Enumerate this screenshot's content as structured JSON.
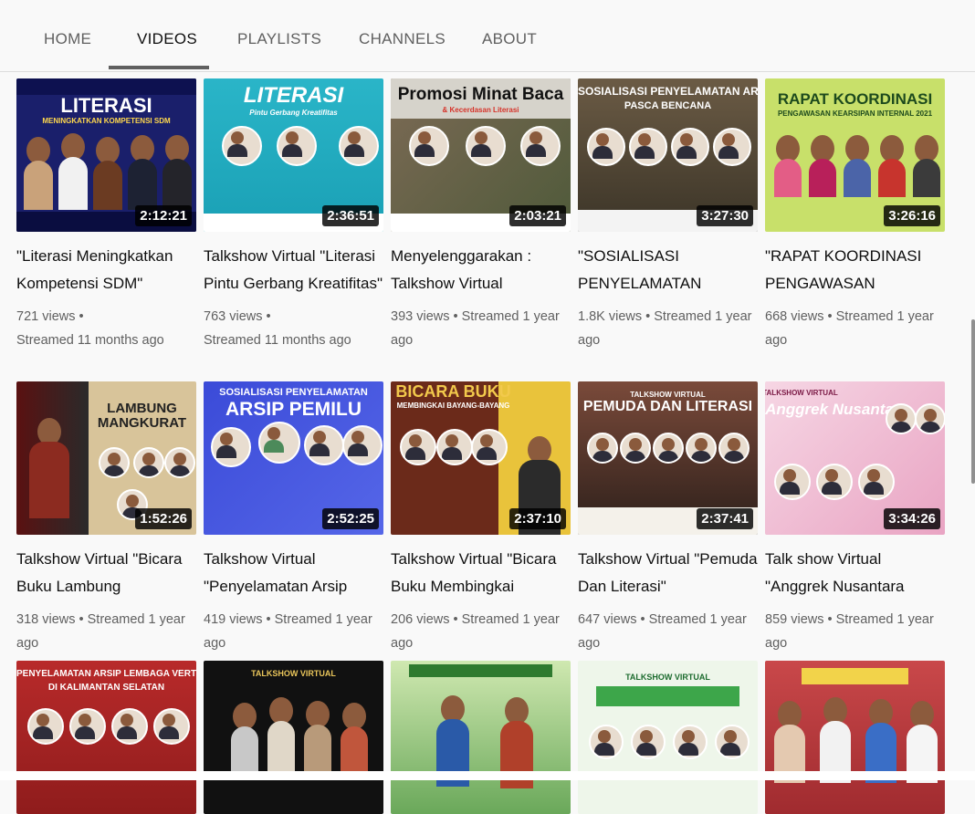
{
  "tabs": [
    {
      "label": "HOME"
    },
    {
      "label": "VIDEOS"
    },
    {
      "label": "PLAYLISTS"
    },
    {
      "label": "CHANNELS"
    },
    {
      "label": "ABOUT"
    }
  ],
  "active_tab": "VIDEOS",
  "videos": [
    {
      "title": "\"Literasi Meningkatkan Kompetensi SDM\"",
      "views": "721 views",
      "date": "Streamed 11 months ago",
      "duration": "2:12:21",
      "thumb_title": "LITERASI",
      "thumb_sub": "MENINGKATKAN KOMPETENSI SDM"
    },
    {
      "title": "Talkshow Virtual \"Literasi Pintu Gerbang Kreatifitas\"",
      "views": "763 views",
      "date": "Streamed 11 months ago",
      "duration": "2:36:51",
      "thumb_title": "LITERASI",
      "thumb_sub": "Pintu Gerbang Kreatifitas"
    },
    {
      "title": "Menyelenggarakan : Talkshow Virtual \"Promosi...",
      "views": "393 views",
      "date": "Streamed 1 year ago",
      "duration": "2:03:21",
      "thumb_title": "Promosi Minat Baca",
      "thumb_sub": "& Kecerdasan Literasi"
    },
    {
      "title": "\"SOSIALISASI PENYELAMATAN ARSIP...",
      "views": "1.8K views",
      "date": "Streamed 1 year ago",
      "duration": "3:27:30",
      "thumb_title": "SOSIALISASI PENYELAMATAN ARSIP",
      "thumb_sub": "PASCA BENCANA"
    },
    {
      "title": "\"RAPAT KOORDINASI PENGAWASAN KEARSIPAN...",
      "views": "668 views",
      "date": "Streamed 1 year ago",
      "duration": "3:26:16",
      "thumb_title": "RAPAT KOORDINASI",
      "thumb_sub": "PENGAWASAN KEARSIPAN INTERNAL 2021"
    },
    {
      "title": "Talkshow Virtual \"Bicara Buku Lambung Mangkurat\"",
      "views": "318 views",
      "date": "Streamed 1 year ago",
      "duration": "1:52:26",
      "thumb_title": "LAMBUNG MANGKURAT",
      "thumb_sub": ""
    },
    {
      "title": "Talkshow Virtual \"Penyelamatan Arsip Pemilu\"",
      "views": "419 views",
      "date": "Streamed 1 year ago",
      "duration": "2:52:25",
      "thumb_title": "ARSIP PEMILU",
      "thumb_sub": "SOSIALISASI PENYELAMATAN"
    },
    {
      "title": "Talkshow Virtual \"Bicara Buku Membingkai Bayang-...",
      "views": "206 views",
      "date": "Streamed 1 year ago",
      "duration": "2:37:10",
      "thumb_title": "BICARA BUKU",
      "thumb_sub": "MEMBINGKAI BAYANG-BAYANG"
    },
    {
      "title": "Talkshow Virtual \"Pemuda Dan Literasi\"",
      "views": "647 views",
      "date": "Streamed 1 year ago",
      "duration": "2:37:41",
      "thumb_title": "PEMUDA DAN LITERASI",
      "thumb_sub": "TALKSHOW VIRTUAL"
    },
    {
      "title": "Talk show Virtual \"Anggrek Nusantara (Menggali...",
      "views": "859 views",
      "date": "Streamed 1 year ago",
      "duration": "3:34:26",
      "thumb_title": "Anggrek Nusantara",
      "thumb_sub": "TALKSHOW VIRTUAL"
    },
    {
      "title": "",
      "views": "",
      "date": "",
      "duration": "",
      "thumb_title": "PENYELAMATAN ARSIP LEMBAGA VERTIKAL",
      "thumb_sub": "DI KALIMANTAN SELATAN"
    },
    {
      "title": "",
      "views": "",
      "date": "",
      "duration": "",
      "thumb_title": "TALKSHOW VIRTUAL",
      "thumb_sub": ""
    },
    {
      "title": "",
      "views": "",
      "date": "",
      "duration": "",
      "thumb_title": "",
      "thumb_sub": ""
    },
    {
      "title": "",
      "views": "",
      "date": "",
      "duration": "",
      "thumb_title": "TALKSHOW VIRTUAL",
      "thumb_sub": ""
    },
    {
      "title": "",
      "views": "",
      "date": "",
      "duration": "",
      "thumb_title": "",
      "thumb_sub": ""
    }
  ],
  "colors": {
    "tab_text": "#606060",
    "tab_active": "#0f0f0f",
    "meta_text": "#606060",
    "duration_bg": "#000000"
  }
}
